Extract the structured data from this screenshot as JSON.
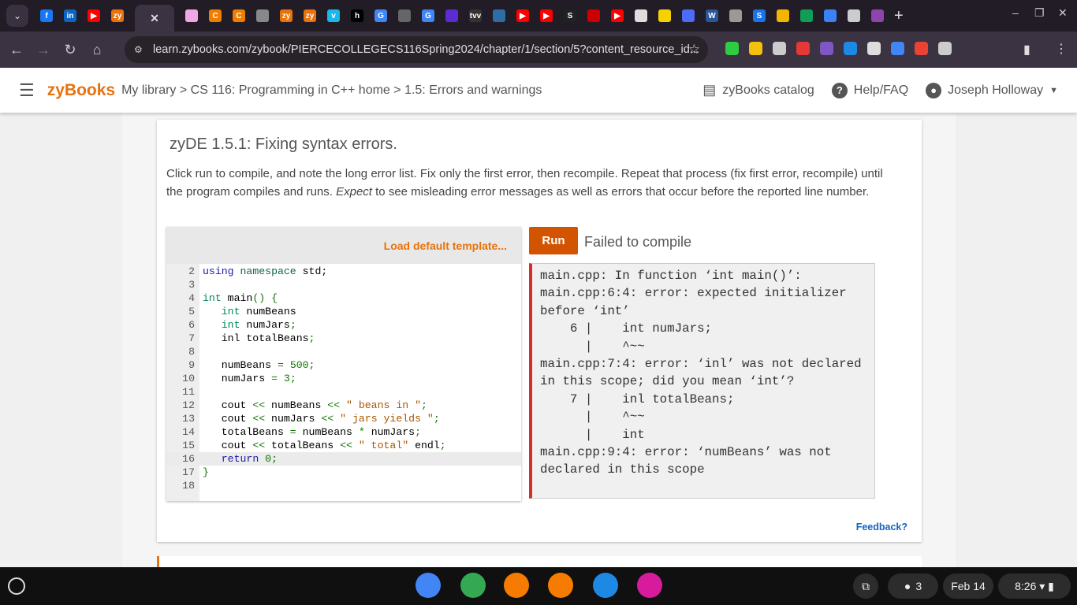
{
  "browser": {
    "tabs": [
      {
        "label": "f",
        "color": "#1877f2"
      },
      {
        "label": "in",
        "color": "#0a66c2"
      },
      {
        "label": "▶",
        "color": "#ff0000"
      },
      {
        "label": "zy",
        "color": "#e8720c"
      },
      {
        "label": "✕",
        "active": true
      },
      {
        "label": "",
        "color": "#f4a6e0"
      },
      {
        "label": "C",
        "color": "#ef7d00"
      },
      {
        "label": "C",
        "color": "#ef7d00"
      },
      {
        "label": "",
        "color": "#888"
      },
      {
        "label": "zy",
        "color": "#e8720c"
      },
      {
        "label": "zy",
        "color": "#e8720c"
      },
      {
        "label": "v",
        "color": "#1ab7ea"
      },
      {
        "label": "h",
        "color": "#000"
      },
      {
        "label": "G",
        "color": "#4285f4"
      },
      {
        "label": "",
        "color": "#666"
      },
      {
        "label": "G",
        "color": "#4285f4"
      },
      {
        "label": "",
        "color": "#5b2bd6"
      },
      {
        "label": "tvv",
        "color": "#333"
      },
      {
        "label": "",
        "color": "#2d6fa3"
      },
      {
        "label": "▶",
        "color": "#ff0000"
      },
      {
        "label": "▶",
        "color": "#ff0000"
      },
      {
        "label": "S",
        "color": "#222"
      },
      {
        "label": "",
        "color": "#c00"
      },
      {
        "label": "▶",
        "color": "#ff0000"
      },
      {
        "label": "",
        "color": "#ddd"
      },
      {
        "label": "",
        "color": "#f4d100"
      },
      {
        "label": "",
        "color": "#4a6cf7"
      },
      {
        "label": "W",
        "color": "#2b579a"
      },
      {
        "label": "",
        "color": "#999"
      },
      {
        "label": "S",
        "color": "#1a73e8"
      },
      {
        "label": "",
        "color": "#f4b400"
      },
      {
        "label": "",
        "color": "#0f9d58"
      },
      {
        "label": "",
        "color": "#3b82f6"
      },
      {
        "label": "",
        "color": "#ccc"
      },
      {
        "label": "",
        "color": "#8e44ad"
      }
    ],
    "new_tab": "+",
    "url": "learn.zybooks.com/zybook/PIERCECOLLEGECS116Spring2024/chapter/1/section/5?content_resource_id...",
    "extensions": [
      "#2ecc40",
      "#f4c20d",
      "#ccc",
      "#e53935",
      "#7e57c2",
      "#1e88e5",
      "#ddd",
      "#4285f4",
      "#ea4335",
      "#ccc"
    ]
  },
  "header": {
    "logo": "zyBooks",
    "breadcrumb": "My library > CS 116: Programming in C++ home > 1.5: Errors and warnings",
    "catalog": "zyBooks catalog",
    "help": "Help/FAQ",
    "user": "Joseph Holloway"
  },
  "zyde": {
    "title": "zyDE 1.5.1: Fixing syntax errors.",
    "instructions_a": "Click run to compile, and note the long error list. Fix only the first error, then recompile. Repeat that process (fix first error, recompile) until the program compiles and runs. ",
    "instructions_em": "Expect",
    "instructions_b": " to see misleading error messages as well as errors that occur before the reported line number.",
    "load_template": "Load default template...",
    "run": "Run",
    "status": "Failed to compile",
    "code": [
      {
        "n": "2",
        "html": "<span class='kw'>using</span> <span class='nm'>namespace</span> std;"
      },
      {
        "n": "3",
        "html": ""
      },
      {
        "n": "4",
        "html": "<span class='ty'>int</span> main<span class='op'>()</span> <span class='op'>{</span>"
      },
      {
        "n": "5",
        "html": "   <span class='ty'>int</span> numBeans"
      },
      {
        "n": "6",
        "html": "   <span class='ty'>int</span> numJars<span class='op'>;</span>"
      },
      {
        "n": "7",
        "html": "   inl totalBeans<span class='op'>;</span>"
      },
      {
        "n": "8",
        "html": ""
      },
      {
        "n": "9",
        "html": "   numBeans <span class='op'>=</span> <span class='op'>500;</span>"
      },
      {
        "n": "10",
        "html": "   numJars <span class='op'>=</span> <span class='op'>3;</span>"
      },
      {
        "n": "11",
        "html": ""
      },
      {
        "n": "12",
        "html": "   cout <span class='op'>&lt;&lt;</span> numBeans <span class='op'>&lt;&lt;</span> <span class='st'>\" beans in \"</span><span class='op'>;</span>"
      },
      {
        "n": "13",
        "html": "   cout <span class='op'>&lt;&lt;</span> numJars <span class='op'>&lt;&lt;</span> <span class='st'>\" jars yields \"</span><span class='op'>;</span>"
      },
      {
        "n": "14",
        "html": "   totalBeans <span class='op'>=</span> numBeans <span class='op'>*</span> numJars<span class='op'>;</span>"
      },
      {
        "n": "15",
        "html": "   cout <span class='op'>&lt;&lt;</span> totalBeans <span class='op'>&lt;&lt;</span> <span class='st'>\" total\"</span> endl<span class='op'>;</span>"
      },
      {
        "n": "16",
        "html": "   <span class='kw'>return</span> <span class='op'>0;</span>",
        "current": true
      },
      {
        "n": "17",
        "html": "<span class='op'>}</span>"
      },
      {
        "n": "18",
        "html": ""
      }
    ],
    "output": "main.cpp: In function ‘int main()’:\nmain.cpp:6:4: error: expected initializer before ‘int’\n    6 |    int numJars;\n      |    ^~~\nmain.cpp:7:4: error: ‘inl’ was not declared in this scope; did you mean ‘int’?\n    7 |    inl totalBeans;\n      |    ^~~\n      |    int\nmain.cpp:9:4: error: ‘numBeans’ was not declared in this scope",
    "feedback": "Feedback?"
  },
  "taskbar": {
    "apps": [
      {
        "name": "chrome",
        "color": "#4285f4"
      },
      {
        "name": "play-store",
        "color": "#34a853"
      },
      {
        "name": "vlc",
        "color": "#f57c00"
      },
      {
        "name": "vlc-2",
        "color": "#f57c00"
      },
      {
        "name": "files",
        "color": "#1e88e5"
      },
      {
        "name": "app",
        "color": "#d81b9c"
      }
    ],
    "notifications": "3",
    "date": "Feb 14",
    "time": "8:26"
  }
}
